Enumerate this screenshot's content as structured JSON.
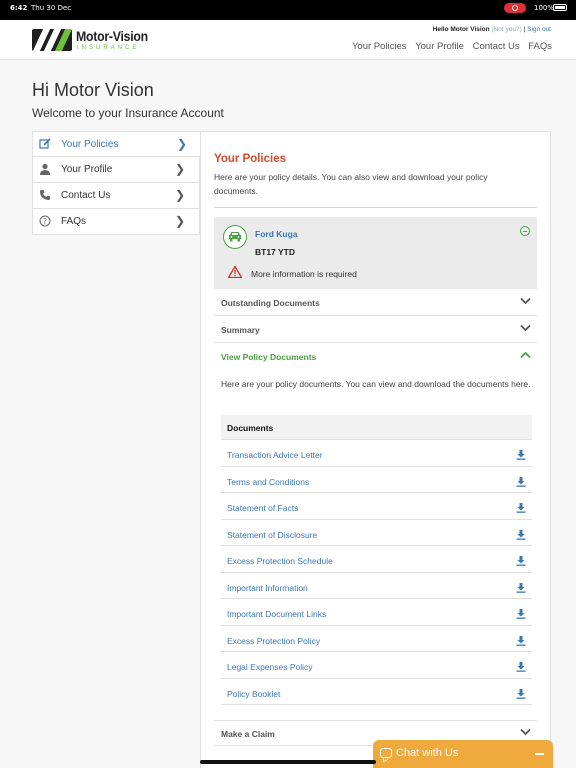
{
  "status_bar": {
    "time": "6:42",
    "date": "Thu 30 Dec",
    "battery": "100%"
  },
  "header": {
    "logo_text": "Motor-Vision",
    "logo_sub": "INSURANCE",
    "greeting_prefix": "Hello Motor Vision",
    "not_you": "(Not you?)",
    "separator": "|",
    "sign_out": "Sign out",
    "nav": [
      "Your Policies",
      "Your Profile",
      "Contact Us",
      "FAQs"
    ]
  },
  "page": {
    "title": "Hi Motor Vision",
    "subtitle": "Welcome to your Insurance Account"
  },
  "sidebar": {
    "items": [
      {
        "label": "Your Policies",
        "icon": "edit-icon",
        "active": true
      },
      {
        "label": "Your Profile",
        "icon": "user-icon",
        "active": false
      },
      {
        "label": "Contact Us",
        "icon": "phone-icon",
        "active": false
      },
      {
        "label": "FAQs",
        "icon": "question-icon",
        "active": false
      }
    ]
  },
  "main": {
    "title": "Your Policies",
    "description": "Here are your policy details. You can also view and download your policy documents.",
    "policy": {
      "vehicle": "Ford Kuga",
      "registration": "BT17 YTD",
      "warning": "More information is required"
    },
    "sections": {
      "outstanding": "Outstanding Documents",
      "summary": "Summary",
      "view_docs": "View Policy Documents",
      "make_claim": "Make a Claim"
    },
    "docs_intro": "Here are your policy documents. You can view and download the documents here.",
    "docs_header": "Documents",
    "documents": [
      "Transaction Advice Letter",
      "Terms and Conditions",
      "Statement of Facts",
      "Statement of Disclosure",
      "Excess Protection Schedule",
      "Important Information",
      "Important Document Links",
      "Excess Protection Policy",
      "Legal Expenses Policy",
      "Policy Booklet"
    ]
  },
  "chat": {
    "label": "Chat with Us"
  },
  "colors": {
    "accent_blue": "#3a78b5",
    "accent_green": "#4aa043",
    "title_red": "#d24b2e",
    "chat_orange": "#f0a93c"
  }
}
